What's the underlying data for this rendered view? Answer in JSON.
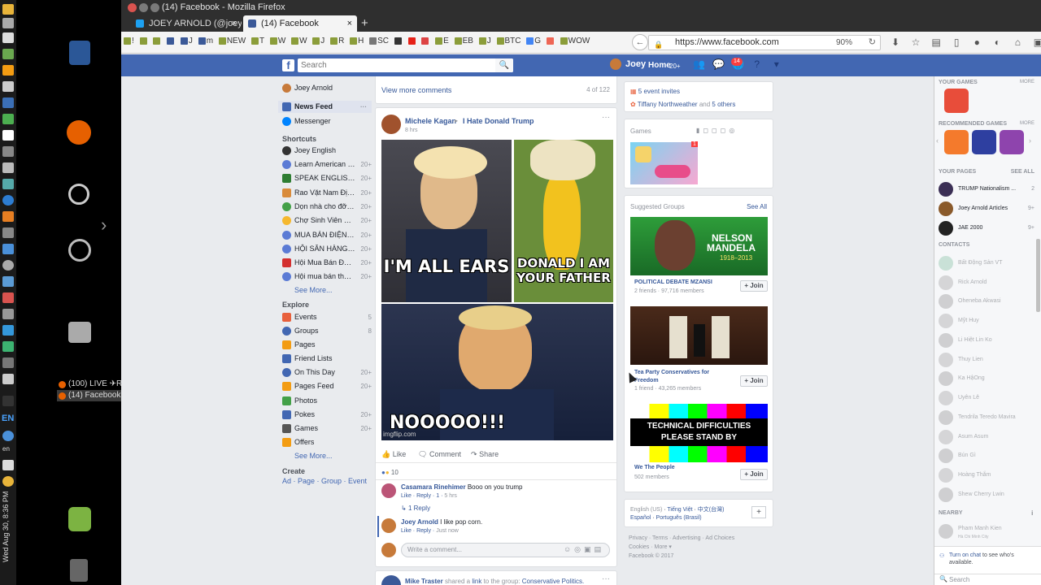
{
  "window": {
    "title": "(14) Facebook - Mozilla Firefox"
  },
  "desktop": {
    "taskbar_items": [
      "(100) LIVE ✈R...",
      "(14) Facebook -..."
    ],
    "clock": "Wed Aug 30,  8:36 PM",
    "lang": "EN",
    "lang2": "en"
  },
  "tabs": [
    {
      "label": "JOEY ARNOLD (@joey..."
    },
    {
      "label": "(14) Facebook"
    }
  ],
  "bookmarks": [
    "!",
    "",
    "",
    "",
    "J",
    "m",
    "NEW",
    "T",
    "W",
    "W",
    "J",
    "R",
    "H",
    "SC",
    "",
    "",
    "",
    "E",
    "EB",
    "J",
    "BTC",
    "G",
    "",
    "WOW"
  ],
  "url": {
    "value": "https://www.facebook.com",
    "zoom": "90%"
  },
  "fb_header": {
    "logo": "f",
    "search_placeholder": "Search",
    "user": "Joey",
    "home": "Home",
    "home_badge": "20+",
    "notif_count": "14"
  },
  "left_nav": {
    "profile": "Joey Arnold",
    "news_feed": "News Feed",
    "messenger": "Messenger",
    "shortcuts_label": "Shortcuts",
    "shortcuts": [
      {
        "label": "Joey English",
        "count": ""
      },
      {
        "label": "Learn American En...",
        "count": "20+"
      },
      {
        "label": "SPEAK ENGLISH ...",
        "count": "20+"
      },
      {
        "label": "Rao Vặt Nam Định",
        "count": "20+"
      },
      {
        "label": "Dọn nhà cho đỡ chật",
        "count": "20+"
      },
      {
        "label": "Chợ Sinh Viên Sư ...",
        "count": "20+"
      },
      {
        "label": "MUA BÁN ĐIỆN T...",
        "count": "20+"
      },
      {
        "label": "HỘI SĂN HÀNG M...",
        "count": "20+"
      },
      {
        "label": "Hội Mua Bán Đồ Cũ...",
        "count": "20+"
      },
      {
        "label": "Hội mua bán thanh l...",
        "count": "20+"
      }
    ],
    "see_more": "See More...",
    "explore_label": "Explore",
    "explore": [
      {
        "label": "Events",
        "count": "5"
      },
      {
        "label": "Groups",
        "count": "8"
      },
      {
        "label": "Pages",
        "count": ""
      },
      {
        "label": "Friend Lists",
        "count": ""
      },
      {
        "label": "On This Day",
        "count": "20+"
      },
      {
        "label": "Pages Feed",
        "count": "20+"
      },
      {
        "label": "Photos",
        "count": ""
      },
      {
        "label": "Pokes",
        "count": "20+"
      },
      {
        "label": "Games",
        "count": "20+"
      },
      {
        "label": "Offers",
        "count": ""
      }
    ],
    "see_more2": "See More...",
    "create_label": "Create",
    "create_links": "Ad · Page · Group · Event"
  },
  "feed": {
    "prev": {
      "view_more": "View more comments",
      "count": "4 of 122"
    },
    "post": {
      "author": "Michele Kagan",
      "group": "I Hate Donald Trump",
      "time": "8 hrs",
      "meme_text_1": "I'M ALL EARS",
      "meme_text_2": "DONALD I AM YOUR FATHER",
      "meme_text_3": "NOOOOO!!!",
      "watermark": "imgflip.com",
      "like": "Like",
      "comment": "Comment",
      "share": "Share",
      "reactions": "10",
      "comments": [
        {
          "author": "Casamara Rinehimer",
          "text": "Booo on you trump",
          "meta_like": "Like",
          "meta_reply": "Reply",
          "meta_count": "1",
          "meta_time": "5 hrs"
        },
        {
          "author": "Joey Arnold",
          "text": "I like pop corn.",
          "meta_like": "Like",
          "meta_reply": "Reply",
          "meta_time": "Just now"
        }
      ],
      "replies": "1 Reply",
      "write_placeholder": "Write a comment..."
    },
    "next": {
      "author": "Mike Traster",
      "text1": "shared a",
      "link": "link",
      "text2": "to the group:",
      "group": "Conservative Politics."
    }
  },
  "right": {
    "events": {
      "invites": "5 event invites",
      "person": "Tiffany Northweather",
      "and": "and",
      "others": "5 others"
    },
    "games": {
      "title": "Games",
      "badge": "1"
    },
    "suggested": {
      "title": "Suggested Groups",
      "see_all": "See All",
      "groups": [
        {
          "name": "POLITICAL DEBATE MZANSI",
          "members": "2 friends · 97,716 members",
          "image_text_1": "NELSON",
          "image_text_2": "MANDELA",
          "image_text_3": "1918–2013"
        },
        {
          "name": "Tea Party Conservatives for Freedom",
          "members": "1 friend · 43,265 members"
        },
        {
          "name": "We The People",
          "members": "502 members",
          "image_text": "TECHNICAL DIFFICULTIES PLEASE STAND BY"
        }
      ],
      "join": "+ Join"
    },
    "languages": {
      "current": "English (US)",
      "l1": "Tiếng Việt",
      "l2": "中文(台灣)",
      "l3": "Español",
      "l4": "Português (Brasil)",
      "plus": "+"
    },
    "footer": {
      "line1": "Privacy · Terms · Advertising · Ad Choices",
      "line2": "Cookies · More ▾",
      "line3": "Facebook © 2017"
    }
  },
  "chat": {
    "your_games": "YOUR GAMES",
    "more": "MORE",
    "recommended": "RECOMMENDED GAMES",
    "more2": "MORE",
    "your_pages": "YOUR PAGES",
    "see_all": "SEE ALL",
    "pages": [
      {
        "name": "TRUMP Nationalism ...",
        "count": "2"
      },
      {
        "name": "Joey Arnold Articles",
        "count": "9+"
      },
      {
        "name": "JAE 2000",
        "count": "9+"
      }
    ],
    "contacts_label": "CONTACTS",
    "contacts": [
      "Bất Động Sản VT",
      "Rick Arnold",
      "Oheneba Akwasi",
      "Mỹt Huy",
      "Li Hiệt Lin Ko",
      "Thuy Lien",
      "Ka HậOng",
      "Uyên Lê",
      "Tendrila Teredo Mavira",
      "Asum Asum",
      "Bún Gì",
      "Hoàng Thắm",
      "Shew Cherry Lwin"
    ],
    "nearby": "NEARBY",
    "nearby_contact": "Pham Manh Kien",
    "nearby_sub": "Hà Chi Minh City",
    "turn_on": "Turn on chat",
    "turn_on_rest": "to see who's available.",
    "search": "Search"
  }
}
